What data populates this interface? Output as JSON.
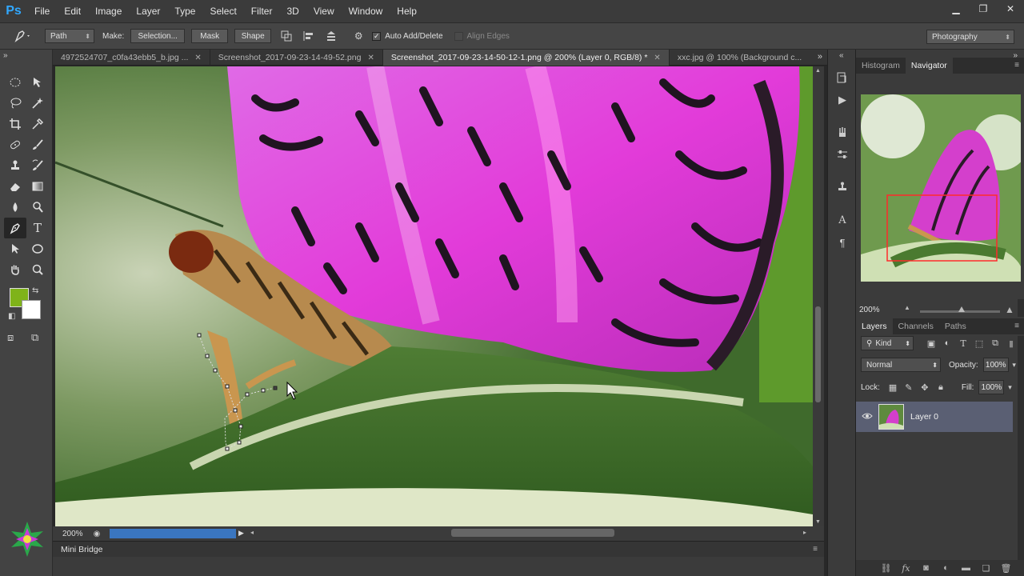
{
  "app": {
    "logo": "Ps"
  },
  "menu": [
    "File",
    "Edit",
    "Image",
    "Layer",
    "Type",
    "Select",
    "Filter",
    "3D",
    "View",
    "Window",
    "Help"
  ],
  "window_controls": {
    "minimize": "▁",
    "restore": "❐",
    "close": "✕"
  },
  "options": {
    "mode": "Path",
    "make_label": "Make:",
    "selection_button": "Selection...",
    "mask_button": "Mask",
    "shape_button": "Shape",
    "auto_add_delete": "Auto Add/Delete",
    "auto_add_delete_checked": true,
    "align_edges": "Align Edges",
    "align_edges_checked": false,
    "workspace": "Photography"
  },
  "colors": {
    "foreground": "#7fb319",
    "background": "#ffffff",
    "accent": "#31a8ff",
    "progress": "#3a76c0"
  },
  "tabs": [
    {
      "label": "4972524707_c0fa43ebb5_b.jpg ...",
      "active": false
    },
    {
      "label": "Screenshot_2017-09-23-14-49-52.png",
      "active": false
    },
    {
      "label": "Screenshot_2017-09-23-14-50-12-1.png @ 200% (Layer 0, RGB/8) *",
      "active": true
    },
    {
      "label": "xxc.jpg @ 100% (Background c...",
      "active": false
    }
  ],
  "status": {
    "zoom": "200%"
  },
  "mini_bridge": "Mini Bridge",
  "navigator": {
    "tabs": [
      "Histogram",
      "Navigator"
    ],
    "active_tab": "Navigator",
    "zoom": "200%"
  },
  "layers": {
    "tabs": [
      "Layers",
      "Channels",
      "Paths"
    ],
    "active_tab": "Layers",
    "kind": "Kind",
    "blend_mode": "Normal",
    "opacity_label": "Opacity:",
    "opacity": "100%",
    "lock_label": "Lock:",
    "fill_label": "Fill:",
    "fill": "100%",
    "items": [
      {
        "name": "Layer 0",
        "visible": true
      }
    ]
  },
  "footer_icons": [
    "link-icon",
    "fx-icon",
    "mask-icon",
    "adjustment-icon",
    "group-icon",
    "new-layer-icon",
    "trash-icon"
  ]
}
